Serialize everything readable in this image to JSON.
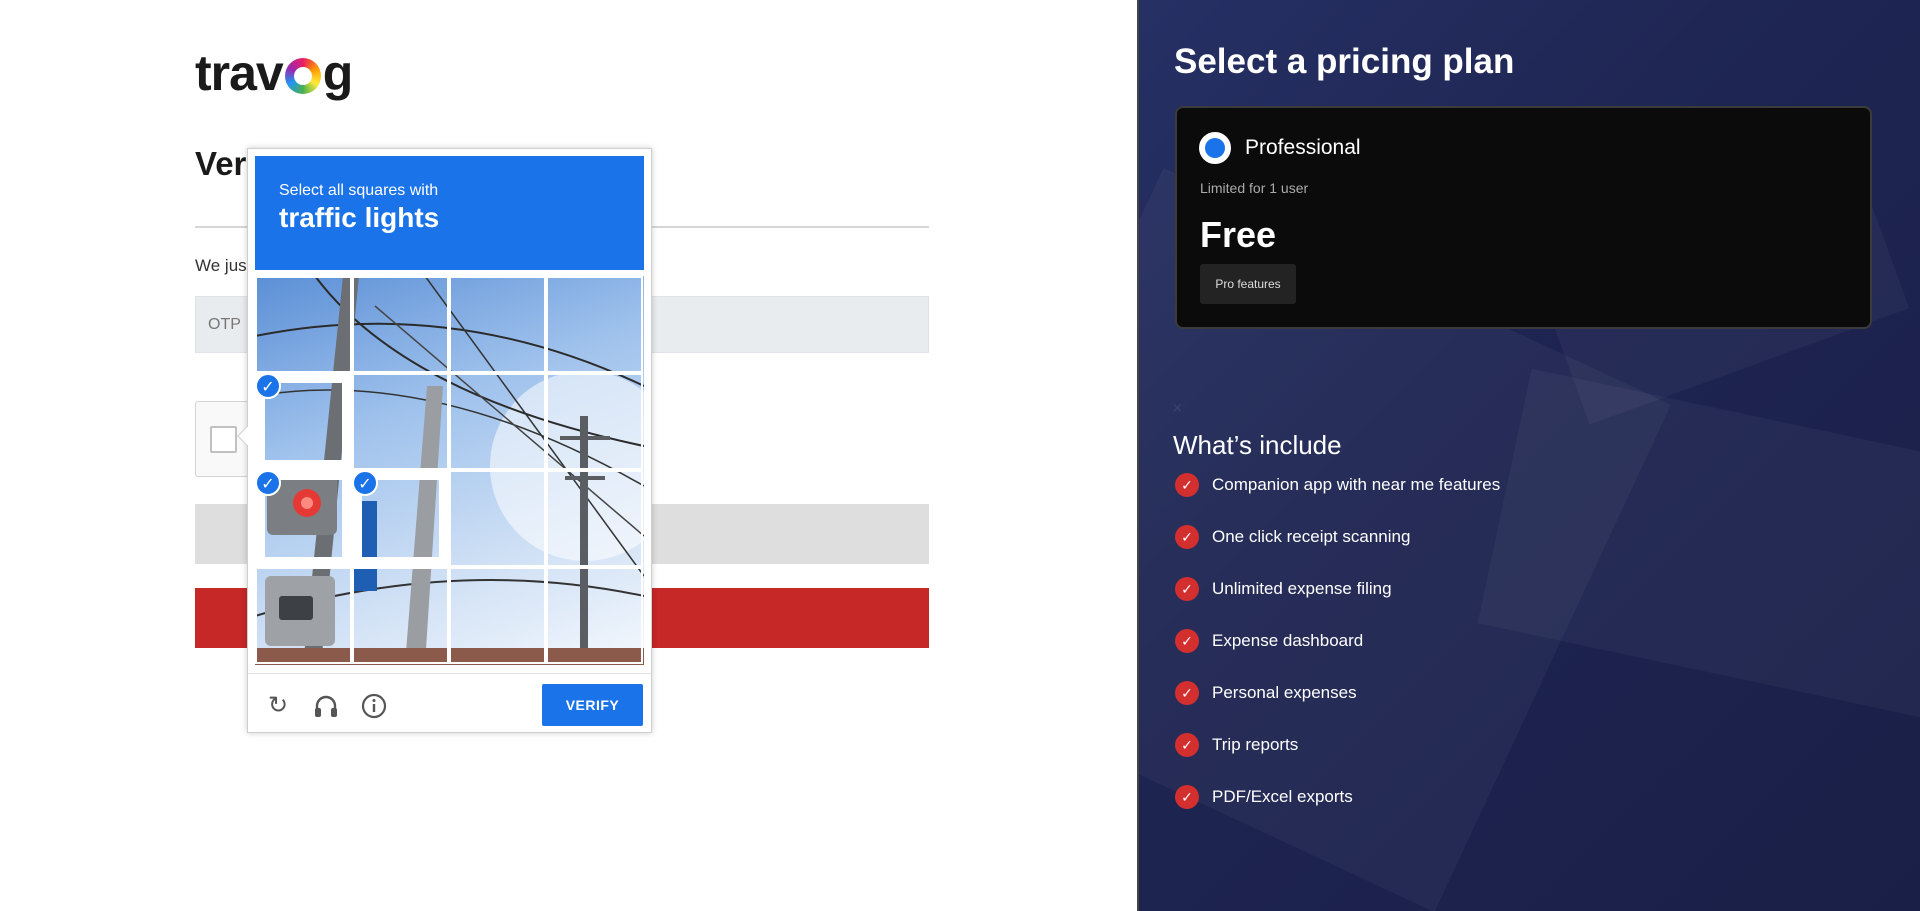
{
  "brand": {
    "logo_left": "trav",
    "logo_right": "g"
  },
  "form": {
    "heading": "Ver",
    "sent_text": "We jus",
    "otp_placeholder": "OTP"
  },
  "captcha": {
    "prompt_small": "Select all squares with",
    "prompt_target": "traffic lights",
    "verify_label": "VERIFY",
    "icons": [
      "reload-icon",
      "audio-icon",
      "info-icon"
    ],
    "selected_tiles": 3,
    "accent_color": "#1a73e8"
  },
  "pricing": {
    "title": "Select a pricing plan",
    "plan": {
      "name": "Professional",
      "limit": "Limited for 1 user",
      "price": "Free",
      "features_button": "Pro features"
    },
    "close_symbol": "×",
    "include_title": "What’s include",
    "features": [
      "Companion app with near me features",
      "One click receipt scanning",
      "Unlimited expense filing",
      "Expense dashboard",
      "Personal expenses",
      "Trip reports",
      "PDF/Excel exports"
    ],
    "check_color": "#d32f2f"
  }
}
